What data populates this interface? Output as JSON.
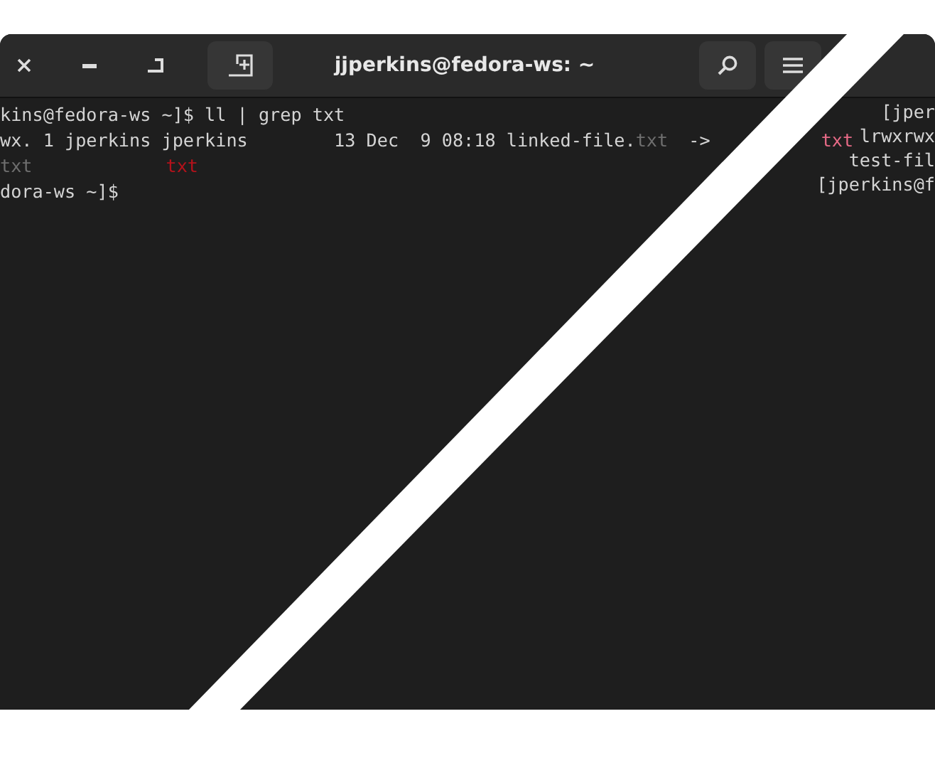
{
  "window": {
    "title": "jjperkins@fedora-ws: ~"
  },
  "terminal": {
    "lines": [
      {
        "segments": [
          {
            "text": "kins@fedora-ws ~]$ ll | grep txt",
            "kind": "normal"
          }
        ]
      },
      {
        "segments": [
          {
            "text": "wx. 1 jperkins jperkins        13 Dec  9 08:18 linked-file.",
            "kind": "normal"
          },
          {
            "text": "txt",
            "kind": "dim"
          },
          {
            "text": " ->",
            "kind": "normal"
          },
          {
            "text": "txt",
            "kind": "pink"
          }
        ]
      },
      {
        "segments": [
          {
            "text": "txt",
            "kind": "dim"
          },
          {
            "text": "txt",
            "kind": "red"
          }
        ]
      },
      {
        "segments": [
          {
            "text": "dora-ws ~]$",
            "kind": "normal"
          }
        ]
      }
    ],
    "fragments": [
      "[jper",
      "lrwxrwx",
      "test-fil",
      "[jperkins@f"
    ]
  }
}
